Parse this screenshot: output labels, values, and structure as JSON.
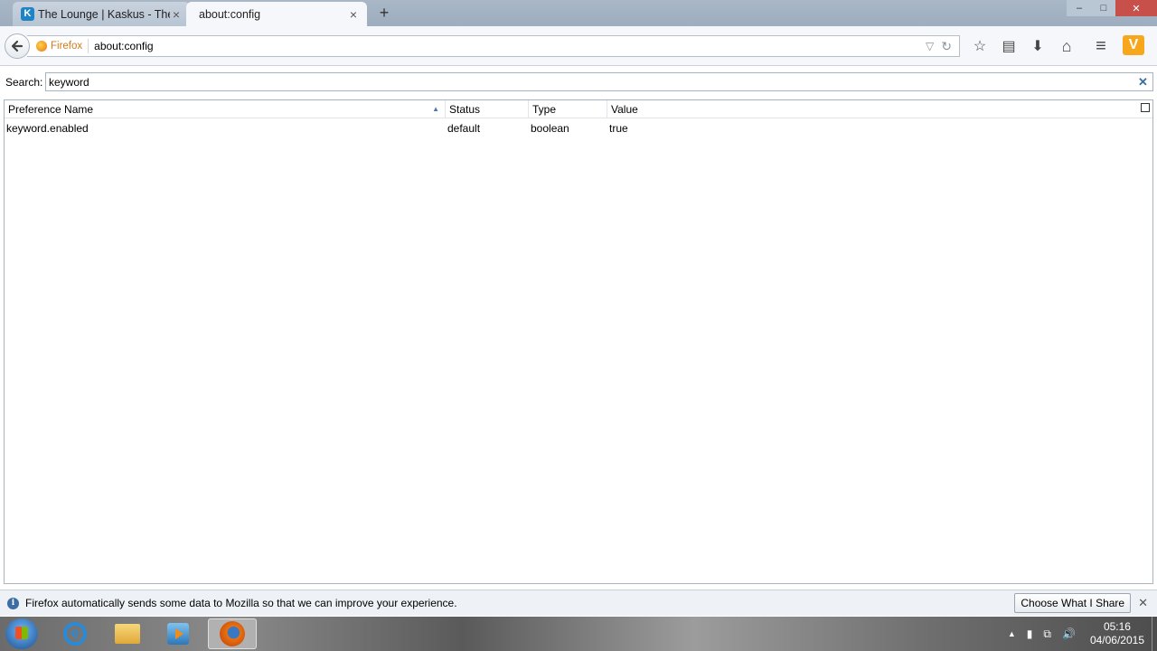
{
  "tabs": [
    {
      "title": "The Lounge | Kaskus - The ...",
      "favicon": "K",
      "close": "×"
    },
    {
      "title": "about:config",
      "close": "×"
    }
  ],
  "new_tab_label": "+",
  "window_controls": [
    "–",
    "□",
    "✕"
  ],
  "urlbar": {
    "identity_label": "Firefox",
    "url": "about:config",
    "dropdown_icon": "▽",
    "reload_icon": "↻"
  },
  "toolbar": {
    "icons": [
      "bookmark-star-icon",
      "reading-list-icon",
      "downloads-icon",
      "home-icon",
      "menu-icon"
    ],
    "glyphs": [
      "☆",
      "▤",
      "⬇",
      "⌂",
      "≡"
    ],
    "addon_glyph": "V"
  },
  "search": {
    "label": "Search:",
    "value": "keyword",
    "clear": "✕"
  },
  "tree": {
    "columns": [
      "Preference Name",
      "Status",
      "Type",
      "Value"
    ],
    "sort_glyph": "▲",
    "rows": [
      {
        "name": "keyword.enabled",
        "status": "default",
        "type": "boolean",
        "value": "true"
      }
    ]
  },
  "notice": {
    "info_glyph": "i",
    "text": "Firefox automatically sends some data to Mozilla so that we can improve your experience.",
    "button": "Choose What I Share",
    "close": "✕"
  },
  "taskbar": {
    "ie_glyph": "e",
    "tray_glyphs": [
      "▲",
      "▮",
      "⧉",
      "🔊"
    ],
    "time": "05:16",
    "date": "04/06/2015"
  },
  "colors": {
    "accent": "#3a6ea5",
    "identity": "#d07b1c",
    "addon": "#f6a71b"
  }
}
